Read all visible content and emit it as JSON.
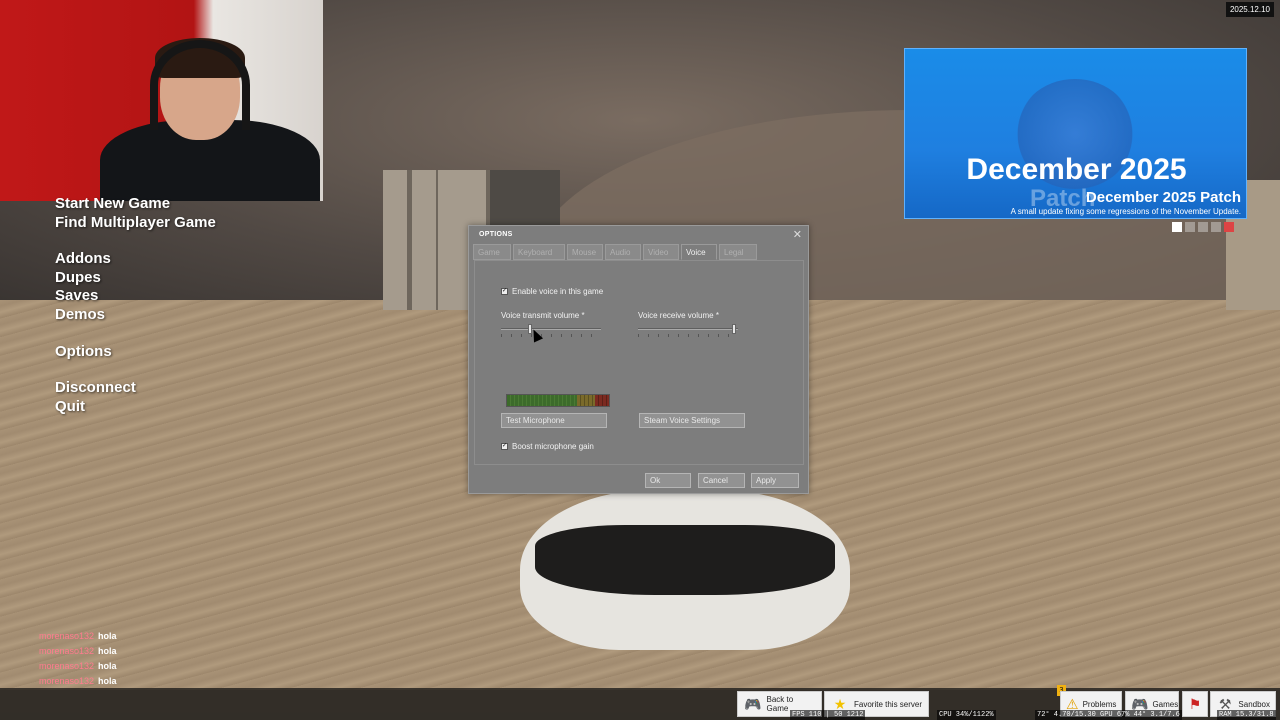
{
  "main_menu": {
    "items": [
      "Start New Game",
      "Find Multiplayer Game",
      "Addons",
      "Dupes",
      "Saves",
      "Demos",
      "Options",
      "Disconnect",
      "Quit"
    ]
  },
  "news": {
    "title": "December 2025",
    "ghost": "Patch",
    "subtitle": "December 2025 Patch",
    "description": "A small update fixing some regressions of the November Update."
  },
  "date_stamp": "2025.12.10",
  "dialog": {
    "title": "OPTIONS",
    "tabs": [
      "Game",
      "Keyboard",
      "Mouse",
      "Audio",
      "Video",
      "Voice",
      "Legal"
    ],
    "active_tab": "Voice",
    "enable_voice_label": "Enable voice in this game",
    "enable_voice_checked": true,
    "transmit_label": "Voice transmit volume *",
    "transmit_value": 0.28,
    "receive_label": "Voice receive volume *",
    "receive_value": 0.98,
    "test_mic_label": "Test Microphone",
    "steam_voice_label": "Steam Voice Settings",
    "boost_label": "Boost microphone gain",
    "boost_checked": true,
    "ok_label": "Ok",
    "cancel_label": "Cancel",
    "apply_label": "Apply"
  },
  "chat": [
    {
      "user": "morenaso132",
      "msg": "hola"
    },
    {
      "user": "morenaso132",
      "msg": "hola"
    },
    {
      "user": "morenaso132",
      "msg": "hola"
    },
    {
      "user": "morenaso132",
      "msg": "hola"
    }
  ],
  "bottom_bar": {
    "back_to_game": "Back to Game",
    "favorite": "Favorite this server",
    "problems": "Problems",
    "problems_count": "3",
    "games": "Games",
    "sandbox": "Sandbox"
  },
  "stats": {
    "fps": "FPS 110 | 50 1212",
    "cpu": "CPU 34%/1122%",
    "gpu": "72° 4.70/15.30 GPU 67% 44° 3.1/7.6",
    "ram": "RAM 15.3/31.8"
  }
}
